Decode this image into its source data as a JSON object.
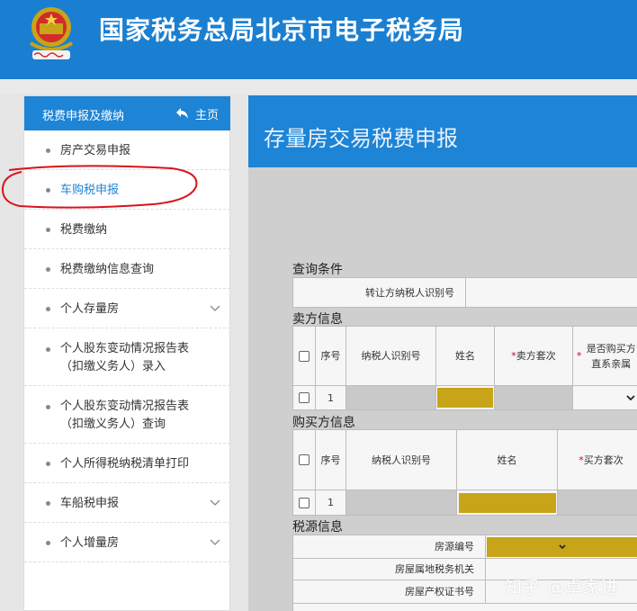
{
  "header": {
    "title": "国家税务总局北京市电子税务局",
    "colors": {
      "brand": "#1a7fd1",
      "accent": "#1d84d6"
    }
  },
  "sidebar": {
    "title": "税费申报及缴纳",
    "home_label": "主页",
    "items": [
      {
        "label": "房产交易申报"
      },
      {
        "label": "车购税申报"
      },
      {
        "label": "税费缴纳"
      },
      {
        "label": "税费缴纳信息查询"
      },
      {
        "label": "个人存量房"
      },
      {
        "line1": "个人股东变动情况报告表",
        "line2": "（扣缴义务人）录入"
      },
      {
        "line1": "个人股东变动情况报告表",
        "line2": "（扣缴义务人）查询"
      },
      {
        "label": "个人所得税纳税清单打印"
      },
      {
        "label": "车船税申报"
      },
      {
        "label": "个人增量房"
      }
    ]
  },
  "main": {
    "title": "存量房交易税费申报",
    "query": {
      "section": "查询条件",
      "transferor_id_label": "转让方纳税人识别号"
    },
    "seller": {
      "section": "卖方信息",
      "headers": [
        "序号",
        "纳税人识别号",
        "姓名",
        "卖方套次",
        "是否购买方直系亲属"
      ],
      "row_index": "1"
    },
    "buyer": {
      "section": "购买方信息",
      "headers": [
        "序号",
        "纳税人识别号",
        "姓名",
        "买方套次"
      ],
      "row_index": "1"
    },
    "tax_source": {
      "section": "税源信息",
      "fields": [
        "房源编号",
        "房屋属地税务机关",
        "房屋产权证书号"
      ]
    }
  },
  "watermark": "知乎 @卓家进"
}
